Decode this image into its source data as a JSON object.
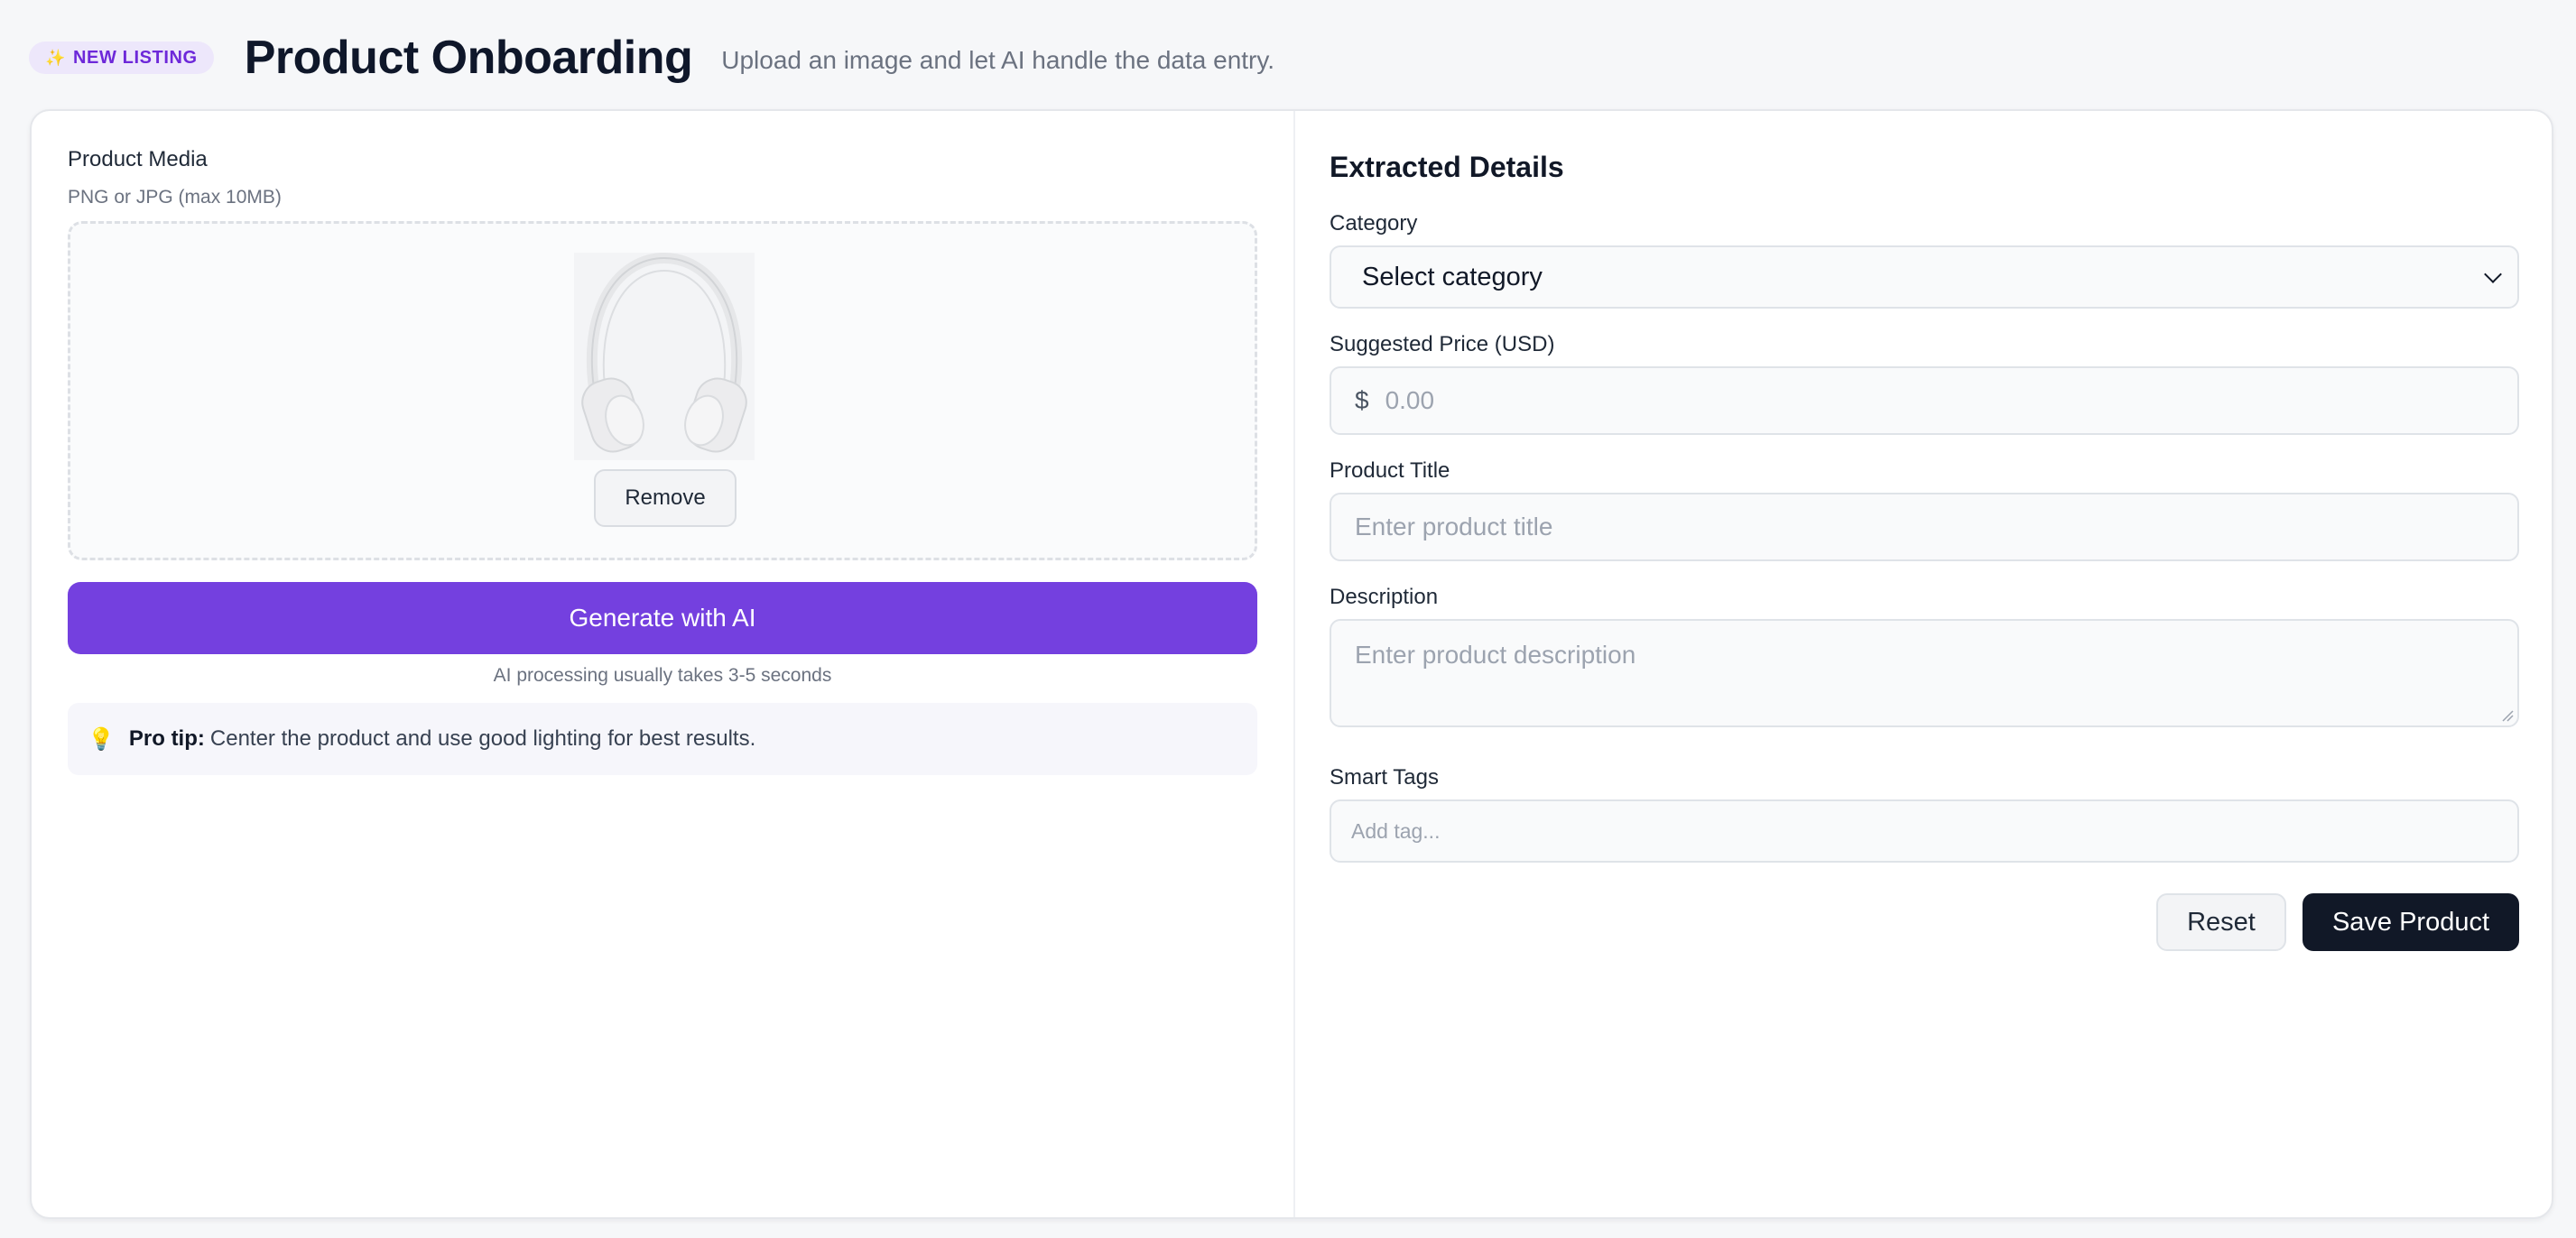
{
  "header": {
    "badge_icon": "✨",
    "badge_label": "NEW LISTING",
    "title": "Product Onboarding",
    "subtitle": "Upload an image and let AI handle the data entry."
  },
  "media": {
    "label": "Product Media",
    "hint": "PNG or JPG (max 10MB)",
    "image_icon": "headphones-image",
    "remove_label": "Remove",
    "generate_label": "Generate with AI",
    "processing_note": "AI processing usually takes 3-5 seconds",
    "tip_icon": "💡",
    "tip_bold": "Pro tip:",
    "tip_text": "Center the product and use good lighting for best results."
  },
  "details": {
    "title": "Extracted Details",
    "category_label": "Category",
    "category_value": "Select category",
    "price_label": "Suggested Price (USD)",
    "price_currency": "$",
    "price_placeholder": "0.00",
    "title_label": "Product Title",
    "title_placeholder": "Enter product title",
    "description_label": "Description",
    "description_placeholder": "Enter product description",
    "tags_label": "Smart Tags",
    "tags_placeholder": "Add tag..."
  },
  "actions": {
    "reset_label": "Reset",
    "save_label": "Save Product"
  },
  "colors": {
    "accent": "#7440df",
    "primary_dark": "#111827",
    "badge_bg": "#ede7fb",
    "badge_text": "#6d28d9"
  }
}
